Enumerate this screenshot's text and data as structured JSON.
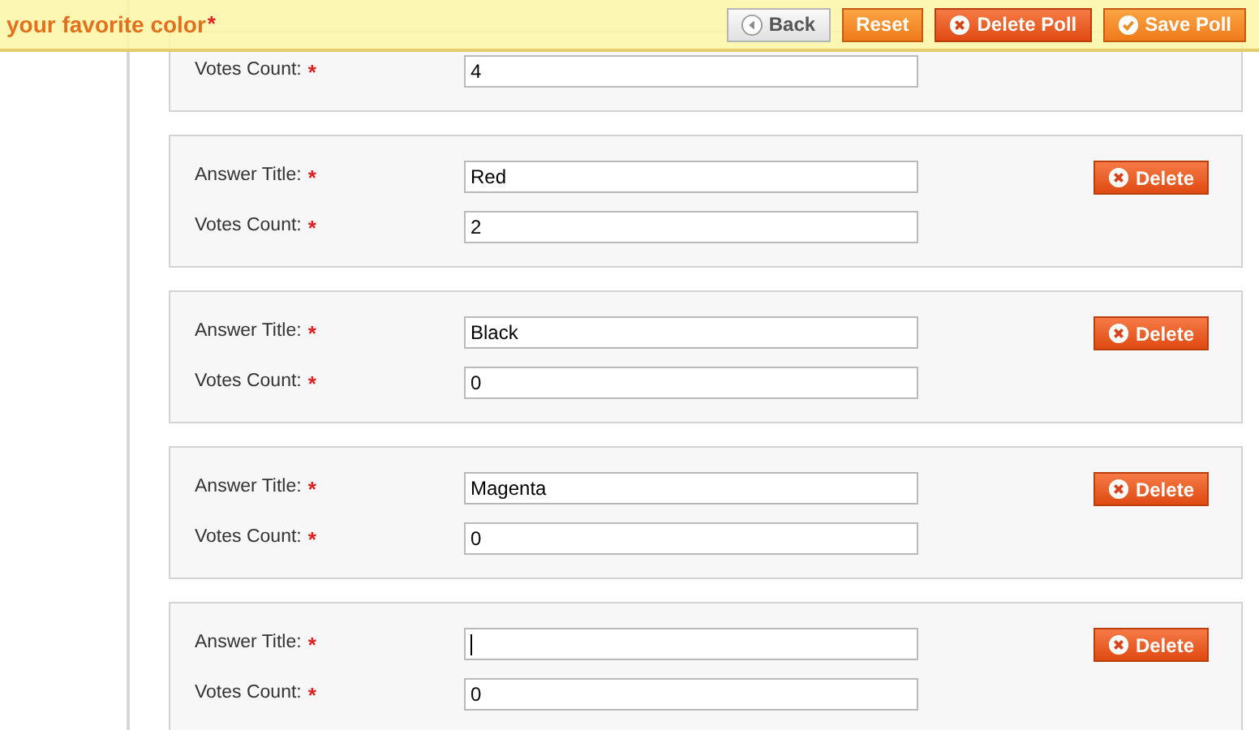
{
  "header": {
    "title": "your favorite color",
    "required_mark": "*",
    "buttons": [
      {
        "label": "Back",
        "kind": "back"
      },
      {
        "label": "Reset",
        "kind": "plain"
      },
      {
        "label": "Delete Poll",
        "kind": "delete"
      },
      {
        "label": "Save Poll",
        "kind": "save"
      }
    ]
  },
  "answers": [
    {
      "votes_label": "Votes Count:",
      "votes_mark": "*",
      "votes": "4"
    },
    {
      "title_label": "Answer Title:",
      "title_mark": "*",
      "title": "Red",
      "votes_label": "Votes Count:",
      "votes_mark": "*",
      "votes": "2",
      "delete_label": "Delete"
    },
    {
      "title_label": "Answer Title:",
      "title_mark": "*",
      "title": "Black",
      "votes_label": "Votes Count:",
      "votes_mark": "*",
      "votes": "0",
      "delete_label": "Delete"
    },
    {
      "title_label": "Answer Title:",
      "title_mark": "*",
      "title": "Magenta",
      "votes_label": "Votes Count:",
      "votes_mark": "*",
      "votes": "0",
      "delete_label": "Delete"
    },
    {
      "title_label": "Answer Title:",
      "title_mark": "*",
      "votes_label": "Votes Count:",
      "votes_mark": "*",
      "votes": "0",
      "focused": true,
      "delete_label": "Delete"
    }
  ]
}
